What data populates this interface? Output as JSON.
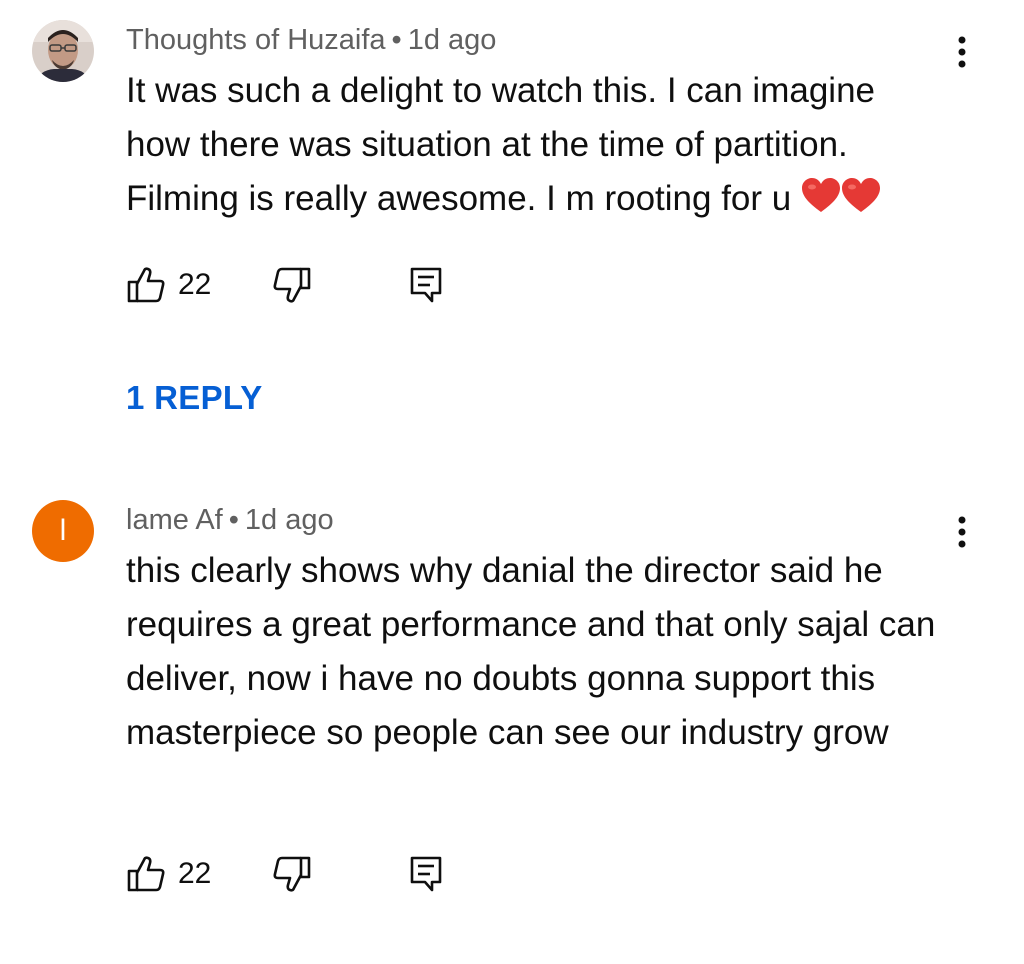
{
  "comments": [
    {
      "author": "Thoughts of Huzaifa",
      "separator": "•",
      "time": "1d ago",
      "text": "It was such a delight to watch this. I can imagine how there was situation at the time of partition. Filming is really awesome. I m rooting for u",
      "trailing_emoji": [
        "red-heart-icon",
        "red-heart-icon"
      ],
      "avatar": {
        "type": "photo"
      },
      "likes": "22",
      "replies_label": "1 REPLY"
    },
    {
      "author": "lame Af",
      "separator": "•",
      "time": "1d ago",
      "text": "this clearly shows why danial the director said he requires a great performance and that only sajal can deliver, now i have no doubts gonna support this masterpiece so people can see our industry grow",
      "avatar": {
        "type": "letter",
        "letter": "l",
        "color": "#ef6c00"
      },
      "likes": "22"
    }
  ],
  "colors": {
    "text": "#0f0f0f",
    "meta": "#606060",
    "link": "#065fd4",
    "heart": "#e53935"
  },
  "icons": {
    "like": "thumbs-up-icon",
    "dislike": "thumbs-down-icon",
    "reply": "reply-comment-icon",
    "more": "more-vert-icon"
  }
}
